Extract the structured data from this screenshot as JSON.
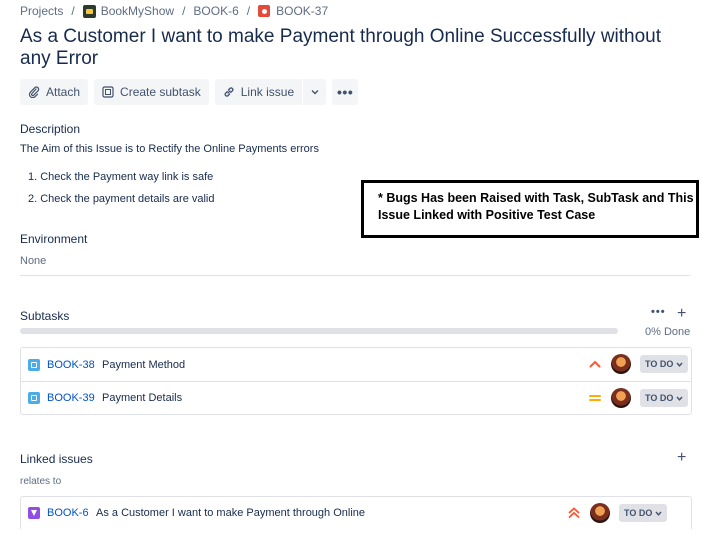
{
  "breadcrumb": {
    "projects": "Projects",
    "project": "BookMyShow",
    "parent": "BOOK-6",
    "current": "BOOK-37",
    "separator": "/"
  },
  "issue": {
    "title": "As a Customer I want to make Payment through Online Successfully without any Error"
  },
  "toolbar": {
    "attach": "Attach",
    "create_subtask": "Create subtask",
    "link_issue": "Link issue",
    "more": "•••"
  },
  "description": {
    "heading": "Description",
    "body": "The Aim of this Issue is to Rectify the Online Payments errors",
    "items": [
      "1. Check the Payment way link is safe",
      "2. Check the payment details are valid"
    ]
  },
  "environment": {
    "heading": "Environment",
    "value": "None"
  },
  "annotation": {
    "line1": "* Bugs Has been Raised with Task, SubTask and This",
    "line2": "Issue Linked with Positive Test Case"
  },
  "subtasks": {
    "heading": "Subtasks",
    "more": "•••",
    "add": "+",
    "progress_label": "0% Done",
    "progress_fraction": 0,
    "items": [
      {
        "key": "BOOK-38",
        "summary": "Payment Method",
        "priority": "high",
        "status": "TO DO"
      },
      {
        "key": "BOOK-39",
        "summary": "Payment Details",
        "priority": "medium",
        "status": "TO DO"
      }
    ]
  },
  "linked": {
    "heading": "Linked issues",
    "add": "+",
    "relation": "relates to",
    "items": [
      {
        "key": "BOOK-6",
        "summary": "As a Customer I want to make Payment through Online",
        "priority": "highest",
        "status": "TO DO"
      }
    ]
  },
  "colors": {
    "link": "#0052cc",
    "priority_high": "#ff5630",
    "priority_medium": "#ffab00",
    "subtask_icon": "#4bade8",
    "epic_icon": "#904ee2",
    "bug_icon": "#e5493a"
  }
}
